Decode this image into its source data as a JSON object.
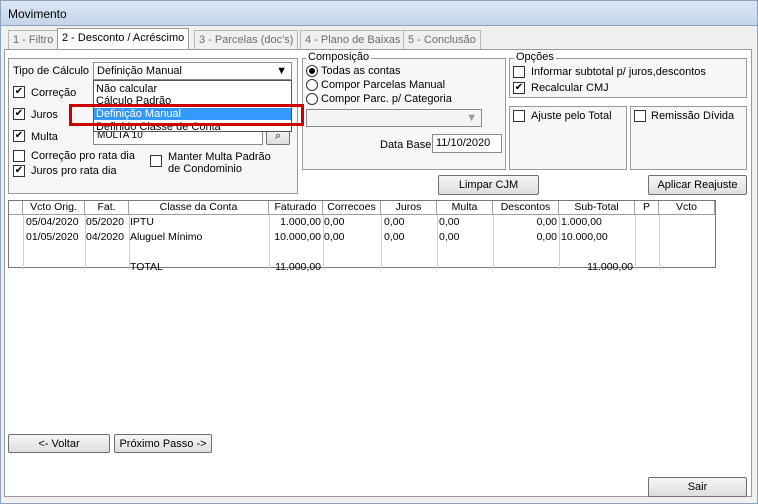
{
  "window": {
    "title": "Movimento"
  },
  "tabs": [
    "1 - Filtro",
    "2 - Desconto / Acréscimo",
    "3 - Parcelas (doc's)",
    "4 - Plano de Baixas",
    "5 - Conclusão"
  ],
  "calc": {
    "label": "Tipo de Cálculo",
    "value": "Definição Manual",
    "options": [
      "Não calcular",
      "Cálculo Padrão",
      "Definição Manual",
      "Definido Classe de Conta"
    ],
    "correcao": "Correção",
    "juros": "Juros",
    "multa": "Multa",
    "multa_value": "MULTA 10",
    "correcao_rata": "Correção pro rata dia",
    "juros_rata": "Juros pro rata dia",
    "manter_multa": "Manter Multa Padrão",
    "manter_multa2": "de Condominio"
  },
  "composicao": {
    "title": "Composição",
    "options": [
      "Todas as contas",
      "Compor Parcelas Manual",
      "Compor Parc. p/ Categoria"
    ],
    "data_base_label": "Data Base",
    "data_base": "11/10/2020"
  },
  "opcoes": {
    "title": "Opções",
    "informar": "Informar subtotal p/ juros,descontos",
    "recalcular": "Recalcular CMJ",
    "ajuste": "Ajuste pelo Total",
    "remissao": "Remissão Dívida"
  },
  "buttons": {
    "limpar": "Limpar CJM",
    "aplicar": "Aplicar Reajuste",
    "voltar": "<- Voltar",
    "proximo": "Próximo Passo ->",
    "sair": "Sair"
  },
  "table": {
    "headers": [
      "Vcto Orig.",
      "Fat.",
      "Classe da Conta",
      "Faturado",
      "Correcoes",
      "Juros",
      "Multa",
      "Descontos",
      "Sub-Total",
      "P",
      "Vcto"
    ],
    "rows": [
      [
        "05/04/2020",
        "05/2020",
        "IPTU",
        "1.000,00",
        "0,00",
        "0,00",
        "0,00",
        "0,00",
        "1.000,00",
        "",
        ""
      ],
      [
        "01/05/2020",
        "04/2020",
        "Aluguel Mínimo",
        "10.000,00",
        "0,00",
        "0,00",
        "0,00",
        "0,00",
        "10.000,00",
        "",
        ""
      ]
    ],
    "total_label": "TOTAL",
    "total_faturado": "11.000,00",
    "total_subtotal": "11.000,00"
  },
  "colors": {
    "highlight": "#cc0000",
    "selection": "#3399ff"
  }
}
